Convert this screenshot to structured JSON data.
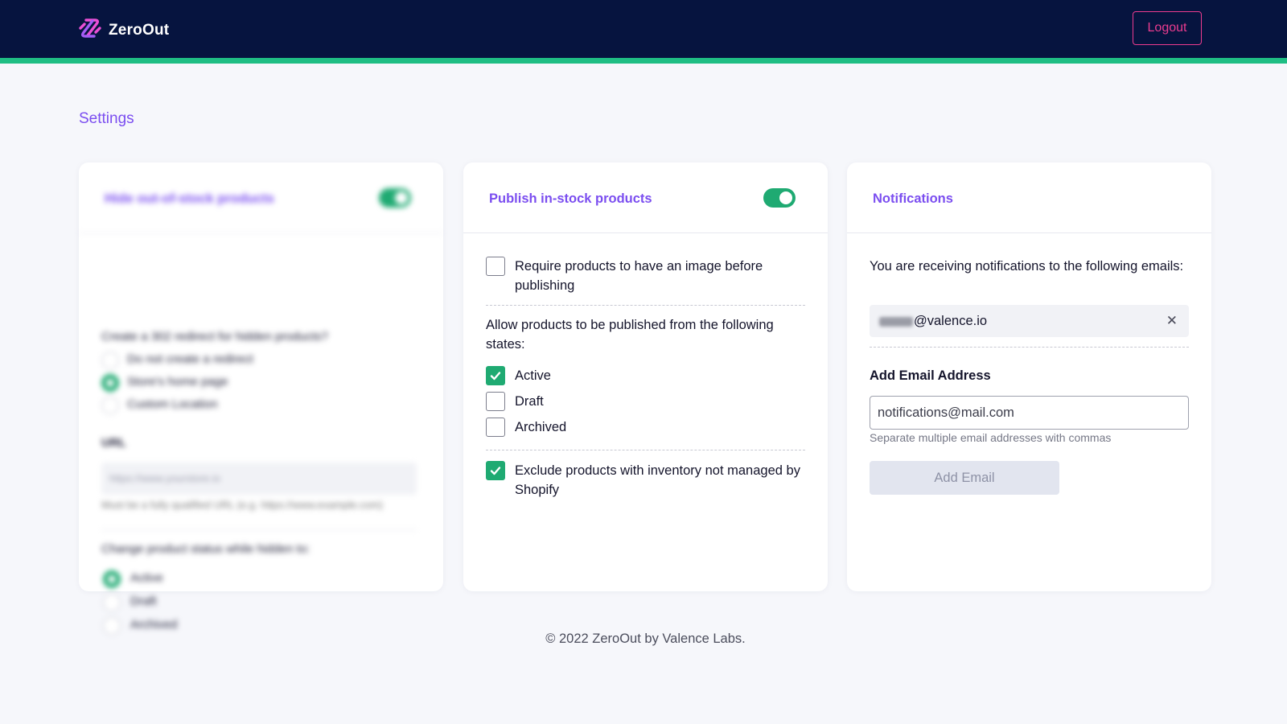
{
  "header": {
    "brand_name": "ZeroOut",
    "logo_icon": "zeroout-logo-icon",
    "logout_label": "Logout",
    "accent_color": "#1fbe84",
    "background_color": "#06143f"
  },
  "page": {
    "title": "Settings"
  },
  "cards": {
    "hide_oos": {
      "title": "Hide out-of-stock products",
      "toggle_on": true,
      "redirect_question": "Create a 302 redirect for hidden products?",
      "redirect_options": [
        "Do not create a redirect",
        "Store's home page",
        "Custom Location"
      ],
      "redirect_selected": "Store's home page",
      "url_label": "URL",
      "url_placeholder": "https://www.yourstore.io",
      "url_help": "Must be a fully qualified URL (e.g. https://www.example.com)",
      "status_question": "Change product status while hidden to:",
      "status_options": [
        "Active",
        "Draft",
        "Archived"
      ],
      "status_selected": "Active"
    },
    "publish": {
      "title": "Publish in-stock products",
      "toggle_on": true,
      "require_image_label": "Require products to have an image before publishing",
      "require_image_checked": false,
      "states_label": "Allow products to be published from the following states:",
      "states": [
        {
          "label": "Active",
          "checked": true
        },
        {
          "label": "Draft",
          "checked": false
        },
        {
          "label": "Archived",
          "checked": false
        }
      ],
      "exclude_label": "Exclude products with inventory not managed by Shopify",
      "exclude_checked": true
    },
    "notifications": {
      "title": "Notifications",
      "intro": "You are receiving notifications to the following emails:",
      "email_visible": "@valence.io",
      "remove_icon": "close-icon",
      "add_label": "Add Email Address",
      "input_placeholder": "notifications@mail.com",
      "help_text": "Separate multiple email addresses with commas",
      "add_button_label": "Add Email"
    }
  },
  "footer": {
    "text": "© 2022 ZeroOut by Valence Labs."
  }
}
